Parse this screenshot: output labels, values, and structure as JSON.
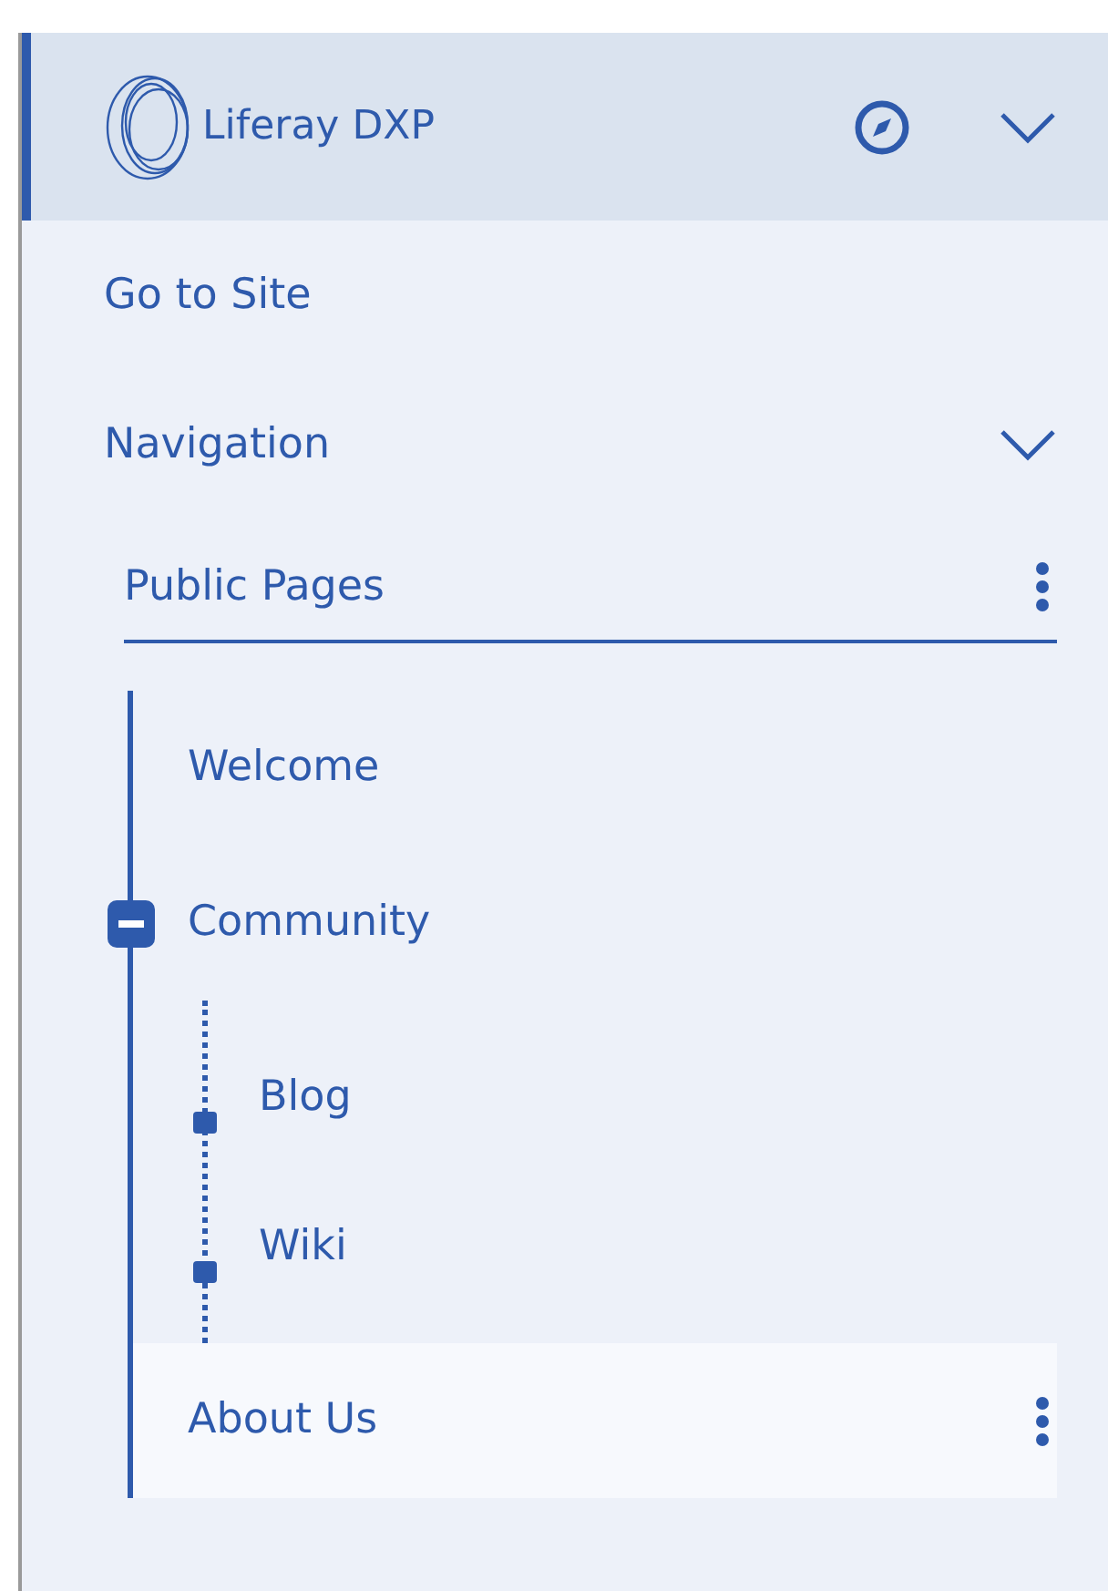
{
  "site": {
    "title": "Liferay DXP",
    "expanded": true
  },
  "links": [
    {
      "label": "Go to Site"
    }
  ],
  "navigation": {
    "label": "Navigation",
    "expanded": true
  },
  "pages_header": {
    "label": "Public Pages"
  },
  "pages": [
    {
      "label": "Welcome",
      "selected": false
    },
    {
      "label": "Community",
      "selected": false,
      "expanded": true,
      "children": [
        {
          "label": "Blog",
          "selected": false
        },
        {
          "label": "Wiki",
          "selected": false
        }
      ]
    },
    {
      "label": "About Us",
      "selected": true
    }
  ]
}
